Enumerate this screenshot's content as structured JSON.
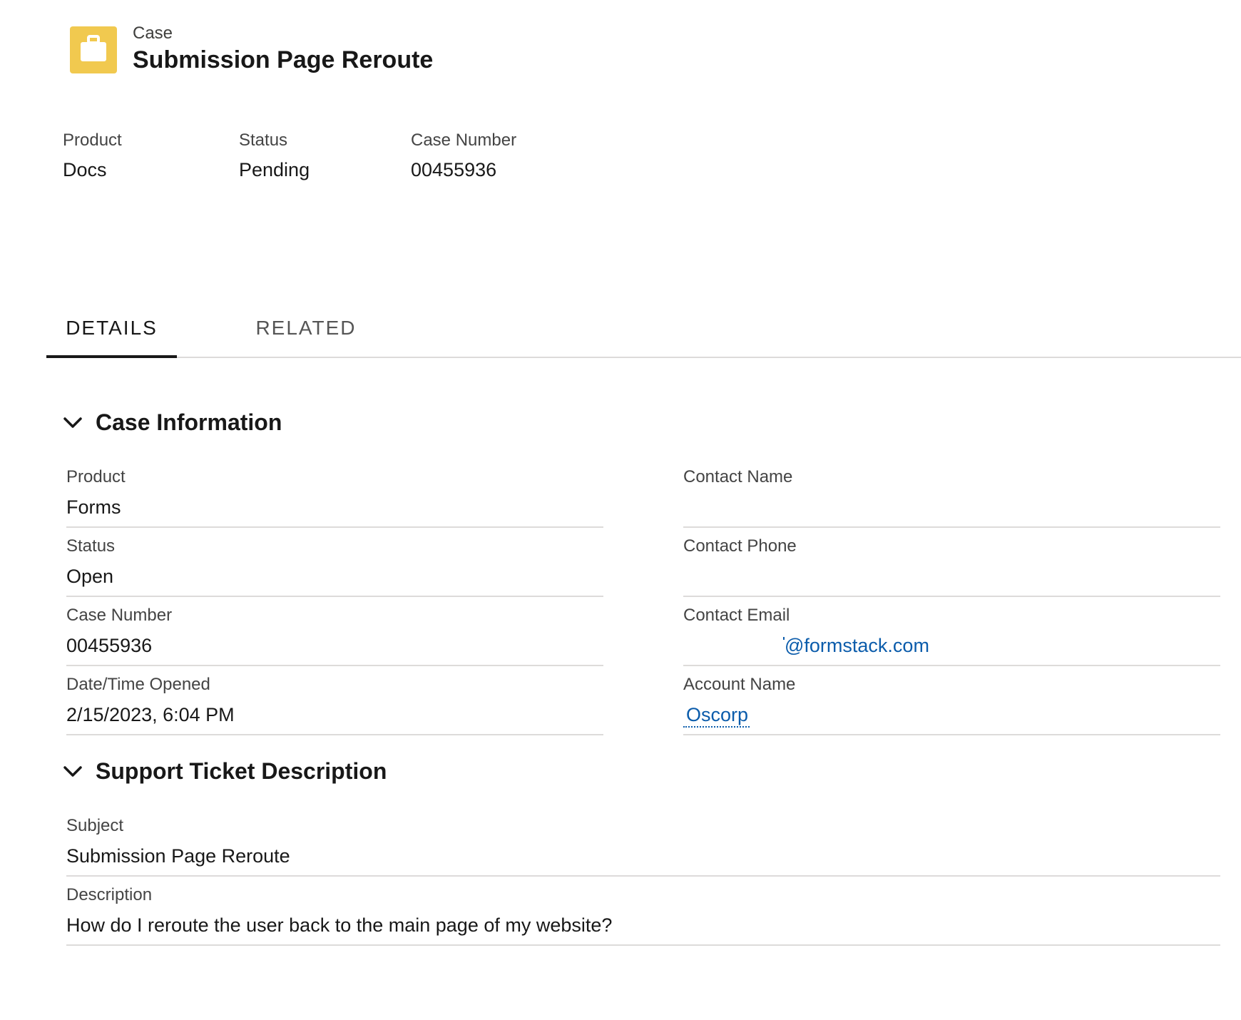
{
  "header": {
    "icon": "briefcase-icon",
    "icon_color": "#f1c94f",
    "object_type": "Case",
    "title": "Submission Page Reroute"
  },
  "highlights": [
    {
      "label": "Product",
      "value": "Docs"
    },
    {
      "label": "Status",
      "value": "Pending"
    },
    {
      "label": "Case Number",
      "value": "00455936"
    }
  ],
  "tabs": [
    {
      "label": "DETAILS",
      "active": true
    },
    {
      "label": "RELATED",
      "active": false
    }
  ],
  "case_information": {
    "title": "Case Information",
    "left": [
      {
        "label": "Product",
        "value": "Forms"
      },
      {
        "label": "Status",
        "value": "Open"
      },
      {
        "label": "Case Number",
        "value": "00455936"
      },
      {
        "label": "Date/Time Opened",
        "value": "2/15/2023, 6:04 PM"
      }
    ],
    "right": [
      {
        "label": "Contact Name",
        "value": ""
      },
      {
        "label": "Contact Phone",
        "value": ""
      },
      {
        "label": "Contact Email",
        "value": "@formstack.com"
      },
      {
        "label": "Account Name",
        "value": "Oscorp"
      }
    ]
  },
  "support_ticket": {
    "title": "Support Ticket Description",
    "fields": [
      {
        "label": "Subject",
        "value": "Submission Page Reroute"
      },
      {
        "label": "Description",
        "value": "How do I reroute the user back to the main page of my website?"
      }
    ]
  },
  "colors": {
    "link": "#0b5cab",
    "divider": "#dddbda",
    "text": "#181818"
  }
}
